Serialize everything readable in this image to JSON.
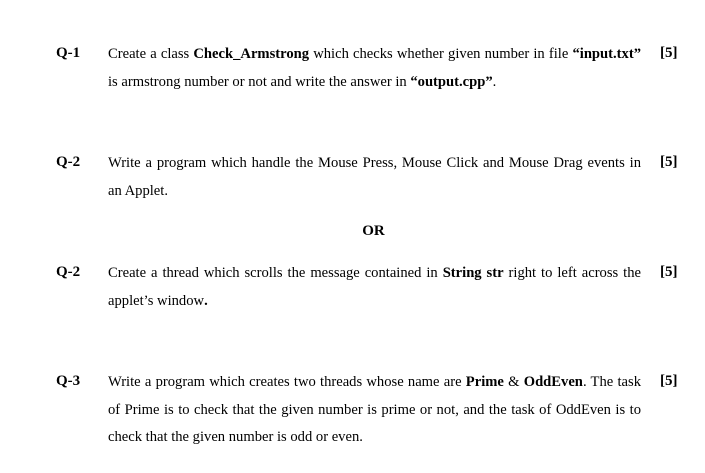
{
  "questions": [
    {
      "label": "Q-1",
      "marks": "[5]",
      "segments": [
        {
          "text": "Create a class ",
          "bold": false
        },
        {
          "text": "Check_Armstrong",
          "bold": true
        },
        {
          "text": " which checks whether given number in file ",
          "bold": false
        },
        {
          "text": "“input.txt”",
          "bold": true
        },
        {
          "text": " is armstrong number or not and write the answer in ",
          "bold": false
        },
        {
          "text": "“output.cpp”",
          "bold": true
        },
        {
          "text": ".",
          "bold": false
        }
      ]
    },
    {
      "label": "Q-2",
      "marks": "[5]",
      "segments": [
        {
          "text": "Write a program which handle the Mouse Press, Mouse Click and Mouse Drag events in an Applet.",
          "bold": false
        }
      ]
    },
    {
      "label": "Q-2",
      "marks": "[5]",
      "segments": [
        {
          "text": "Create a thread which scrolls the message contained in ",
          "bold": false
        },
        {
          "text": "String str",
          "bold": true
        },
        {
          "text": " right to left across the applet’s window",
          "bold": false
        },
        {
          "text": ".",
          "bold": true
        }
      ]
    },
    {
      "label": "Q-3",
      "marks": "[5]",
      "segments": [
        {
          "text": "Write a program which creates two threads whose name are ",
          "bold": false
        },
        {
          "text": "Prime",
          "bold": true
        },
        {
          "text": " & ",
          "bold": false
        },
        {
          "text": "OddEven",
          "bold": true
        },
        {
          "text": ". The task of Prime is to check that the given number is prime or not, and the task of OddEven is to check that the given number is odd or even.",
          "bold": false
        }
      ]
    }
  ],
  "or_text": "OR"
}
